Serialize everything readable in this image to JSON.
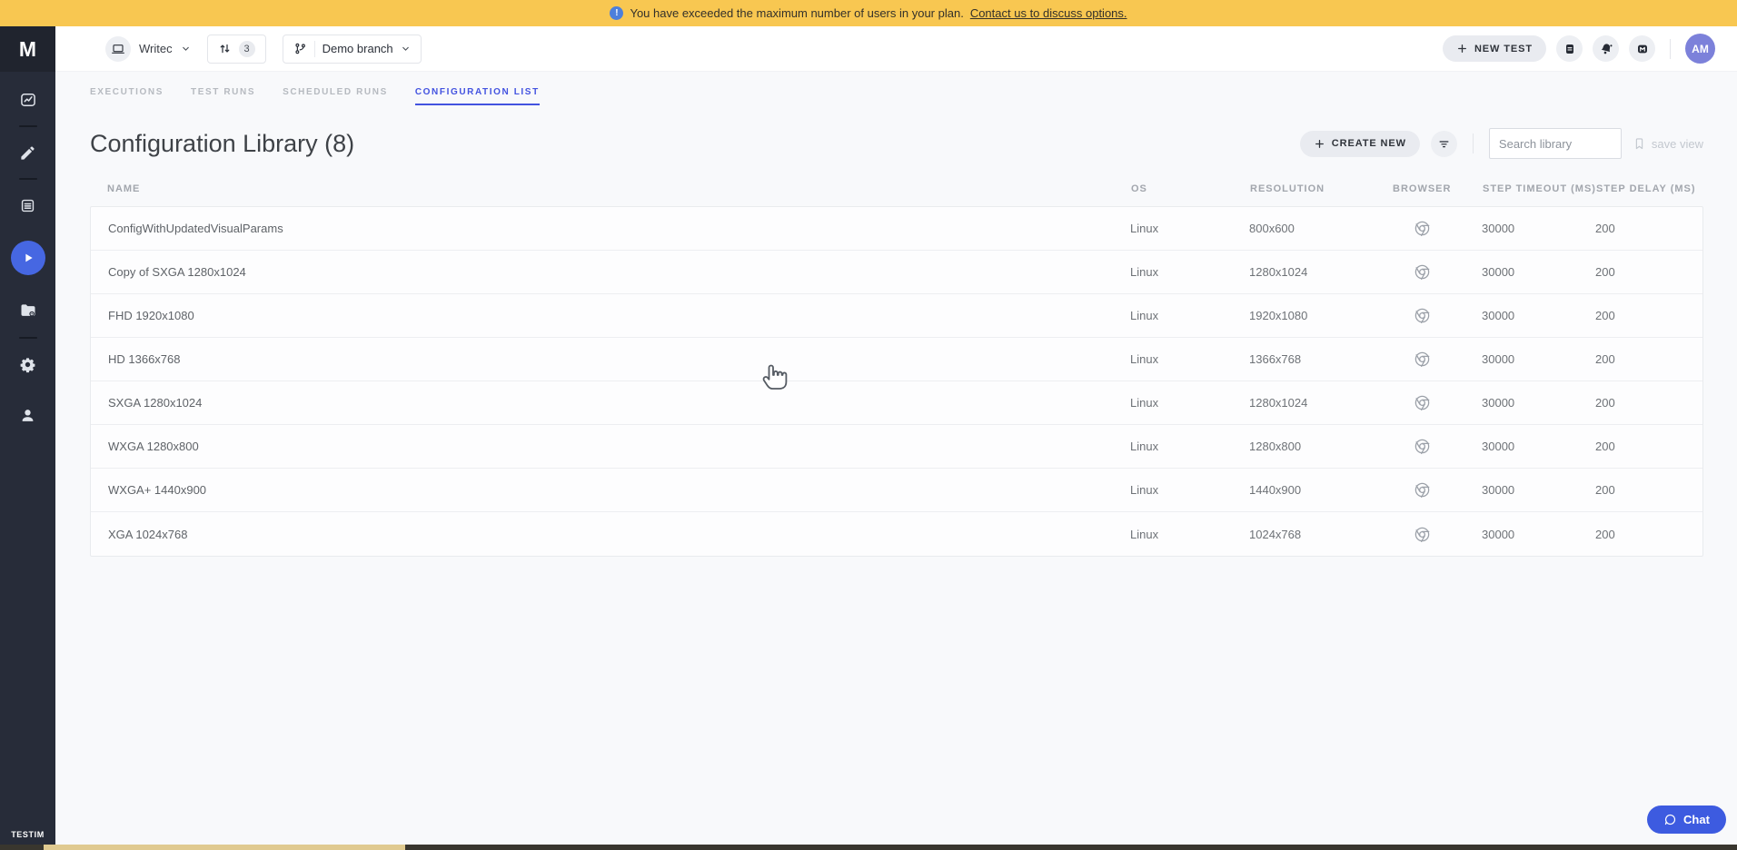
{
  "banner": {
    "text": "You have exceeded the maximum number of users in your plan.",
    "link_text": "Contact us to discuss options."
  },
  "header": {
    "logo_letter": "M",
    "project_name": "Writec",
    "pending_changes_count": "3",
    "branch_name": "Demo branch",
    "new_test_label": "NEW TEST",
    "avatar_initials": "AM"
  },
  "tabs": [
    {
      "label": "EXECUTIONS",
      "active": false
    },
    {
      "label": "TEST RUNS",
      "active": false
    },
    {
      "label": "SCHEDULED RUNS",
      "active": false
    },
    {
      "label": "CONFIGURATION LIST",
      "active": true
    }
  ],
  "page": {
    "title": "Configuration Library (8)",
    "create_new_label": "CREATE NEW",
    "search_placeholder": "Search library",
    "search_value": "",
    "save_view_label": "save view"
  },
  "table": {
    "columns": [
      "NAME",
      "OS",
      "RESOLUTION",
      "BROWSER",
      "STEP TIMEOUT (MS)",
      "STEP DELAY (MS)"
    ],
    "rows": [
      {
        "name": "ConfigWithUpdatedVisualParams",
        "os": "Linux",
        "resolution": "800x600",
        "browser": "chrome",
        "step_timeout": "30000",
        "step_delay": "200"
      },
      {
        "name": "Copy of SXGA 1280x1024",
        "os": "Linux",
        "resolution": "1280x1024",
        "browser": "chrome",
        "step_timeout": "30000",
        "step_delay": "200"
      },
      {
        "name": "FHD 1920x1080",
        "os": "Linux",
        "resolution": "1920x1080",
        "browser": "chrome",
        "step_timeout": "30000",
        "step_delay": "200"
      },
      {
        "name": "HD 1366x768",
        "os": "Linux",
        "resolution": "1366x768",
        "browser": "chrome",
        "step_timeout": "30000",
        "step_delay": "200"
      },
      {
        "name": "SXGA 1280x1024",
        "os": "Linux",
        "resolution": "1280x1024",
        "browser": "chrome",
        "step_timeout": "30000",
        "step_delay": "200"
      },
      {
        "name": "WXGA 1280x800",
        "os": "Linux",
        "resolution": "1280x800",
        "browser": "chrome",
        "step_timeout": "30000",
        "step_delay": "200"
      },
      {
        "name": "WXGA+ 1440x900",
        "os": "Linux",
        "resolution": "1440x900",
        "browser": "chrome",
        "step_timeout": "30000",
        "step_delay": "200"
      },
      {
        "name": "XGA 1024x768",
        "os": "Linux",
        "resolution": "1024x768",
        "browser": "chrome",
        "step_timeout": "30000",
        "step_delay": "200"
      }
    ]
  },
  "sidebar": {
    "brand": "TESTIM",
    "items": [
      {
        "icon": "insights-chart-icon",
        "active": false
      },
      {
        "icon": "editor-pencil-icon",
        "active": false
      },
      {
        "icon": "test-list-icon",
        "active": false
      },
      {
        "icon": "runs-play-icon",
        "active": true
      },
      {
        "icon": "suites-folder-gear-icon",
        "active": false
      },
      {
        "icon": "settings-gear-icon",
        "active": false
      },
      {
        "icon": "user-profile-icon",
        "active": false
      }
    ]
  },
  "chat": {
    "label": "Chat"
  },
  "colors": {
    "banner_bg": "#f8c751",
    "accent_blue": "#4353e0",
    "sidebar_bg": "#272c39",
    "active_item_bg": "#4667e2",
    "avatar_bg": "#7c81da",
    "chat_bg": "#3d5be0"
  }
}
